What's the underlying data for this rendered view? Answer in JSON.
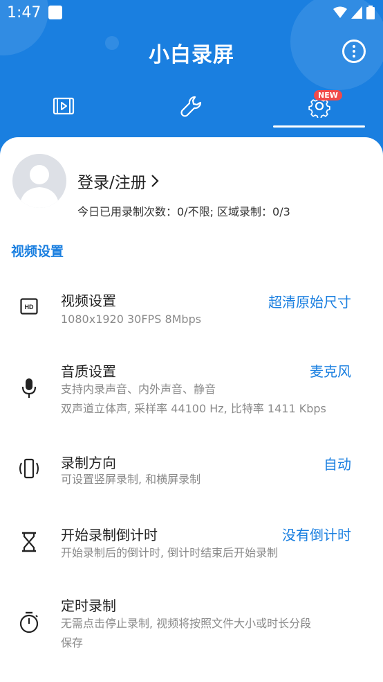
{
  "status_bar": {
    "time": "1:47"
  },
  "header": {
    "title": "小白录屏"
  },
  "tabs": [
    {
      "name": "video-tab"
    },
    {
      "name": "tools-tab"
    },
    {
      "name": "settings-tab",
      "badge": "NEW"
    }
  ],
  "profile": {
    "login_label": "登录/注册",
    "quota_text": "今日已用录制次数：0/不限; 区域录制：0/3"
  },
  "section": {
    "title": "视频设置"
  },
  "settings": [
    {
      "icon": "hd-icon",
      "title": "视频设置",
      "desc": [
        "1080x1920  30FPS  8Mbps"
      ],
      "value": "超清原始尺寸"
    },
    {
      "icon": "microphone-icon",
      "title": "音质设置",
      "desc": [
        "支持内录声音、内外声音、静音",
        "双声道立体声, 采样率 44100 Hz, 比特率 1411 Kbps"
      ],
      "value": "麦克风"
    },
    {
      "icon": "screen-rotation-icon",
      "title": "录制方向",
      "desc": [
        "可设置竖屏录制, 和横屏录制"
      ],
      "value": "自动"
    },
    {
      "icon": "hourglass-icon",
      "title": "开始录制倒计时",
      "desc": [
        "开始录制后的倒计时, 倒计时结束后开始录制"
      ],
      "value": "没有倒计时"
    },
    {
      "icon": "stopwatch-icon",
      "title": "定时录制",
      "desc": [
        "无需点击停止录制, 视频将按照文件大小或时长分段",
        "保存"
      ],
      "value": ""
    }
  ],
  "colors": {
    "accent": "#1a7fe0",
    "badge": "#f04a4a"
  }
}
